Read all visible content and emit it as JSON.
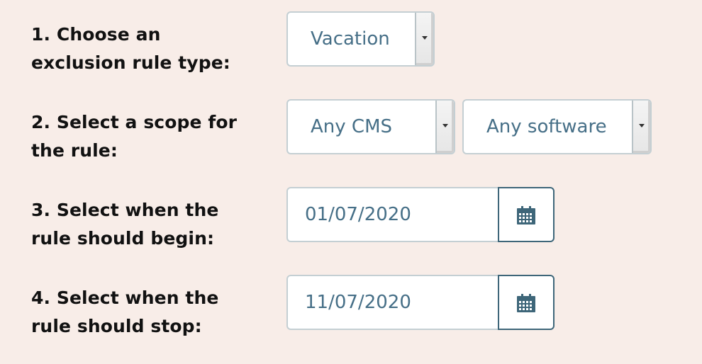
{
  "form": {
    "step1": {
      "label": "1. Choose an\nexclusion rule type:",
      "select_value": "Vacation"
    },
    "step2": {
      "label": "2. Select a scope for\nthe rule:",
      "cms_value": "Any CMS",
      "software_value": "Any software"
    },
    "step3": {
      "label": "3. Select when the\nrule should begin:",
      "date_value": "01/07/2020"
    },
    "step4": {
      "label": "4. Select when the\nrule should stop:",
      "date_value": "11/07/2020"
    }
  },
  "icons": {
    "dropdown": "chevron-down-icon",
    "date_picker": "calendar-icon"
  },
  "colors": {
    "background": "#f8ede8",
    "field_text": "#466f87",
    "date_button_border": "#3e6679"
  }
}
